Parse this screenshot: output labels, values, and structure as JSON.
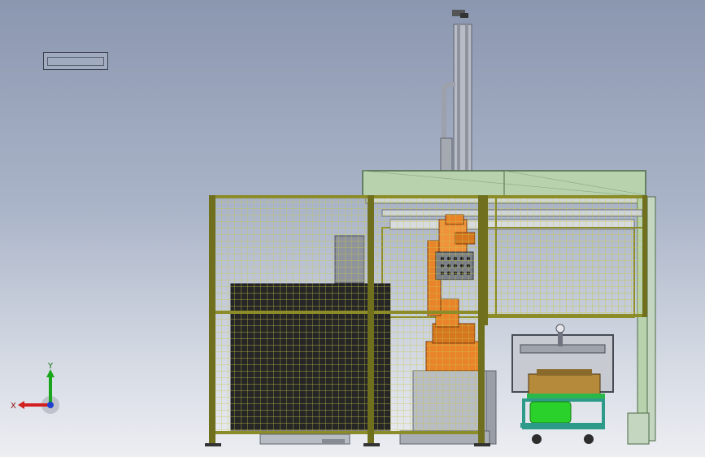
{
  "view": {
    "triad": {
      "x_label": "X",
      "y_label": "Y"
    },
    "colors": {
      "background_top": "#8b97b0",
      "frame_yellow": "#8c8c28",
      "mesh_yellow": "#c8c84a",
      "roof_green": "#b7d2ad",
      "robot_orange": "#e9842a",
      "motor_green": "#2bd12b",
      "cart_teal": "#2e9a8a",
      "axis_x": "#d22020",
      "axis_y": "#1aa61a",
      "axis_z": "#2040d0"
    },
    "icons": [
      "coordinate-triad-icon",
      "view-thumbnail-icon"
    ]
  }
}
